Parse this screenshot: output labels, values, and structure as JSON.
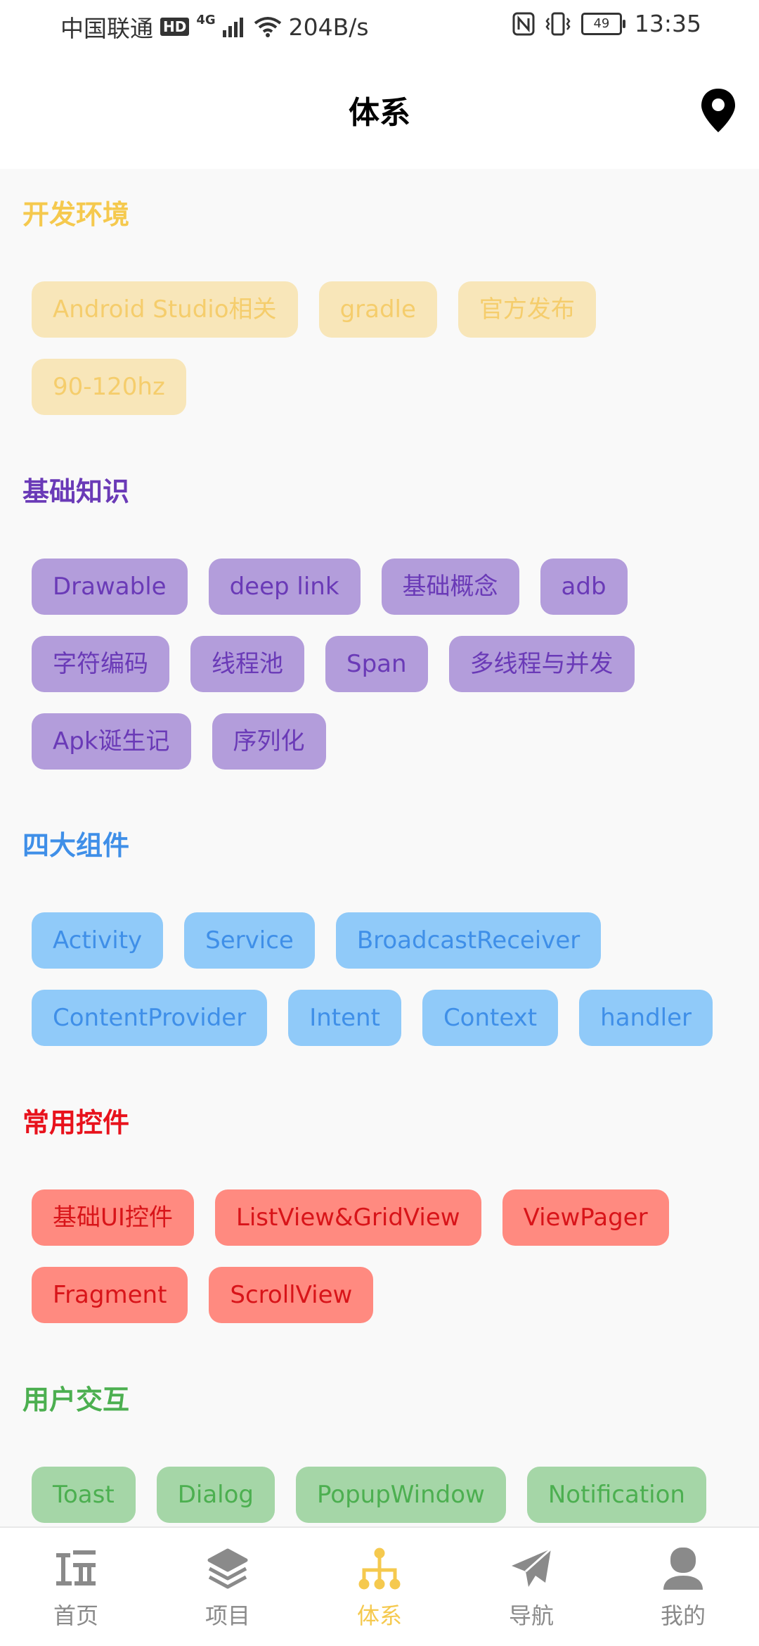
{
  "status_bar": {
    "carrier": "中国联通",
    "hd": "HD",
    "network": "4G",
    "speed": "204B/s",
    "battery": "49",
    "time": "13:35"
  },
  "app_bar": {
    "title": "体系"
  },
  "sections": [
    {
      "title": "开发环境",
      "title_color": "#F5C94E",
      "chip_bg": "#F8E6B9",
      "chip_fg": "#F5CD6C",
      "chips": [
        "Android Studio相关",
        "gradle",
        "官方发布",
        "90-120hz"
      ]
    },
    {
      "title": "基础知识",
      "title_color": "#6A3AB7",
      "chip_bg": "#B39DDB",
      "chip_fg": "#6A3AB7",
      "chips": [
        "Drawable",
        "deep link",
        "基础概念",
        "adb",
        "字符编码",
        "线程池",
        "Span",
        "多线程与并发",
        "Apk诞生记",
        "序列化"
      ]
    },
    {
      "title": "四大组件",
      "title_color": "#3F8FE8",
      "chip_bg": "#90CAF9",
      "chip_fg": "#3F8FE8",
      "chips": [
        "Activity",
        "Service",
        "BroadcastReceiver",
        "ContentProvider",
        "Intent",
        "Context",
        "handler"
      ]
    },
    {
      "title": "常用控件",
      "title_color": "#E8121C",
      "chip_bg": "#FF8A80",
      "chip_fg": "#D81419",
      "chips": [
        "基础UI控件",
        "ListView&GridView",
        "ViewPager",
        "Fragment",
        "ScrollView"
      ]
    },
    {
      "title": "用户交互",
      "title_color": "#4CAF50",
      "chip_bg": "#A5D6A7",
      "chip_fg": "#4CAF50",
      "chips": [
        "Toast",
        "Dialog",
        "PopupWindow",
        "Notification"
      ]
    }
  ],
  "bottom_nav": [
    {
      "label": "首页",
      "icon": "home-wan-icon",
      "active": false
    },
    {
      "label": "项目",
      "icon": "layers-icon",
      "active": false
    },
    {
      "label": "体系",
      "icon": "hierarchy-icon",
      "active": true
    },
    {
      "label": "导航",
      "icon": "paper-plane-icon",
      "active": false
    },
    {
      "label": "我的",
      "icon": "user-icon",
      "active": false
    }
  ],
  "colors": {
    "nav_active": "#F5C94E",
    "nav_inactive": "#8A8A8A"
  }
}
